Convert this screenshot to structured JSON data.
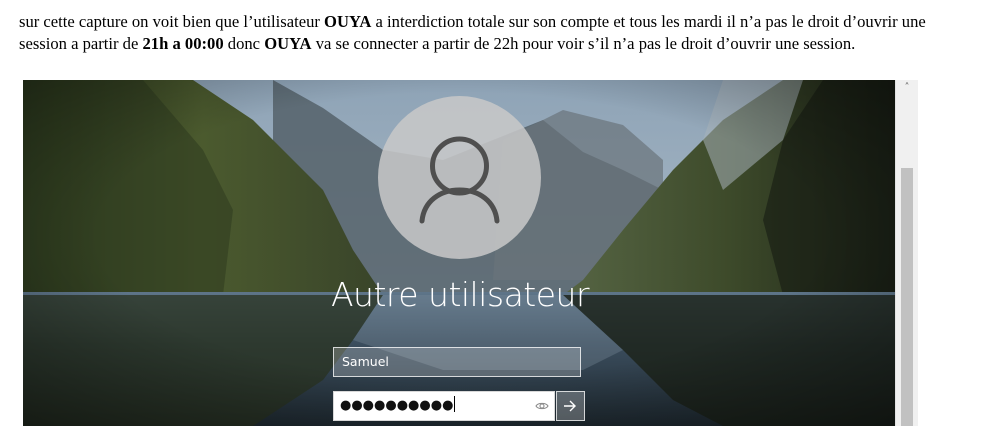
{
  "document": {
    "paragraph": {
      "p1": "sur cette capture on voit bien que l’utilisateur ",
      "b1": "OUYA",
      "p2": " a interdiction totale sur son compte et tous les mardi il n’a pas le droit d’ouvrir une session a partir de ",
      "b2": "21h a 00:00",
      "p3": " donc ",
      "b3": "OUYA",
      "p4": " va se connecter a partir de 22h pour voir s’il n’a pas le droit d’ouvrir une session."
    }
  },
  "login_screen": {
    "display_name": "Autre utilisateur",
    "username_value": "Samuel",
    "password_mask": "●●●●●●●●●●",
    "icons": {
      "avatar": "user-silhouette-icon",
      "reveal_password": "eye-icon",
      "submit": "arrow-right-icon"
    }
  },
  "scrollbar": {
    "up_arrow": "˄",
    "position_fraction": 0.28
  },
  "colors": {
    "text": "#000000",
    "login_text": "#ffffff",
    "avatar_fill": "#c8c8c8"
  }
}
